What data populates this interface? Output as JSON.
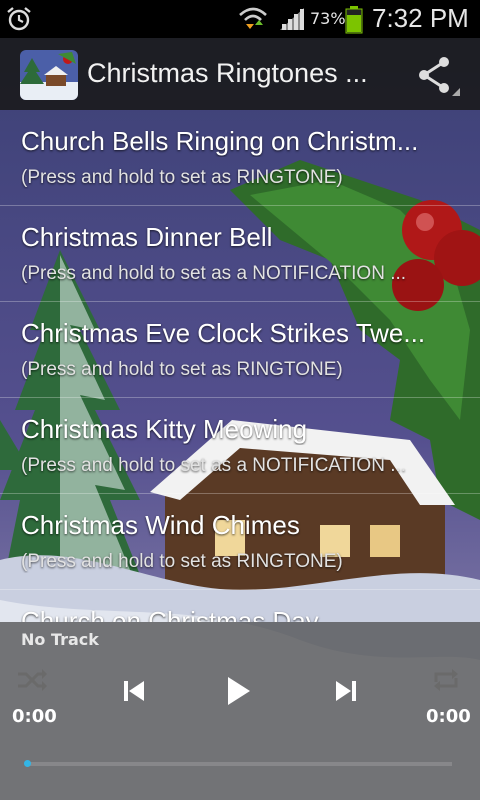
{
  "status_bar": {
    "icons": [
      "alarm-icon",
      "wifi-icon",
      "signal-icon",
      "battery-icon"
    ],
    "battery_percent": "73%",
    "battery_level": 0.73,
    "time": "7:32 PM"
  },
  "action_bar": {
    "title": "Christmas Ringtones ...",
    "icons": [
      "app-icon",
      "share-icon"
    ]
  },
  "ringtones": [
    {
      "title": "Church Bells Ringing on Christm...",
      "subtitle": "(Press and hold to set as RINGTONE)"
    },
    {
      "title": "Christmas Dinner Bell",
      "subtitle": "(Press and hold to set as a NOTIFICATION ..."
    },
    {
      "title": "Christmas Eve Clock Strikes Twe...",
      "subtitle": "(Press and hold to set as RINGTONE)"
    },
    {
      "title": "Christmas Kitty Meowing",
      "subtitle": "(Press and hold to set as a NOTIFICATION ..."
    },
    {
      "title": "Christmas Wind Chimes",
      "subtitle": "(Press and hold to set as RINGTONE)"
    },
    {
      "title": "Church on Christmas Day",
      "subtitle": ""
    }
  ],
  "player": {
    "track": "No Track",
    "elapsed": "0:00",
    "duration": "0:00",
    "progress": 0,
    "icons": [
      "shuffle-icon",
      "previous-icon",
      "play-icon",
      "next-icon",
      "repeat-icon"
    ]
  },
  "colors": {
    "accent": "#33b5e5",
    "status_bar": "#000000",
    "battery": "#7cc400"
  }
}
